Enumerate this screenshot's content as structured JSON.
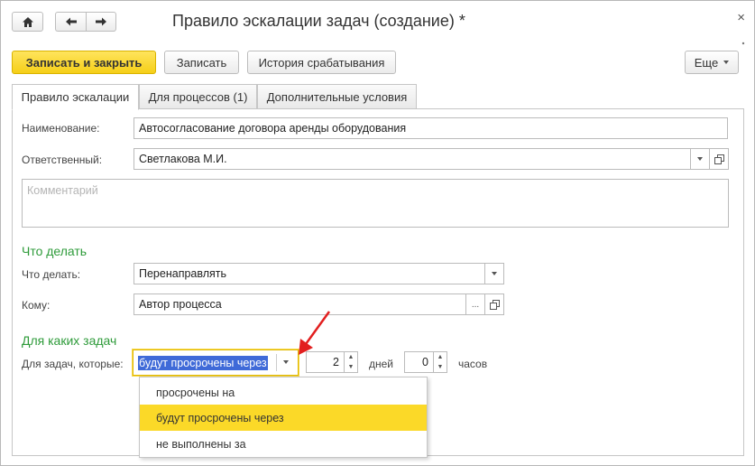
{
  "window": {
    "title": "Правило эскалации задач (создание) *",
    "close_glyph": "×"
  },
  "toolbar": {
    "save_close_label": "Записать и закрыть",
    "save_label": "Записать",
    "history_label": "История срабатывания",
    "more_label": "Еще"
  },
  "tabs": [
    {
      "label": "Правило эскалации",
      "active": true
    },
    {
      "label": "Для процессов (1)",
      "active": false
    },
    {
      "label": "Дополнительные условия",
      "active": false
    }
  ],
  "form": {
    "name_label": "Наименование:",
    "name_value": "Автосогласование договора аренды оборудования",
    "responsible_label": "Ответственный:",
    "responsible_value": "Светлакова М.И.",
    "comment_placeholder": "Комментарий",
    "what_section": "Что делать",
    "what_label": "Что делать:",
    "what_value": "Перенаправлять",
    "to_label": "Кому:",
    "to_value": "Автор процесса",
    "to_ellipsis": "...",
    "which_section": "Для каких задач",
    "which_label": "Для задач, которые:",
    "which_value": "будут просрочены через",
    "days_value": "2",
    "days_label": "дней",
    "hours_value": "0",
    "hours_label": "часов"
  },
  "dropdown": {
    "options": [
      {
        "label": "просрочены на",
        "selected": false
      },
      {
        "label": "будут просрочены через",
        "selected": true
      },
      {
        "label": "не выполнены за",
        "selected": false
      }
    ]
  },
  "colors": {
    "accent_yellow": "#fbd928",
    "section_green": "#2e9b3a",
    "arrow_red": "#e21f1f",
    "selection_blue": "#3f6ad8"
  }
}
